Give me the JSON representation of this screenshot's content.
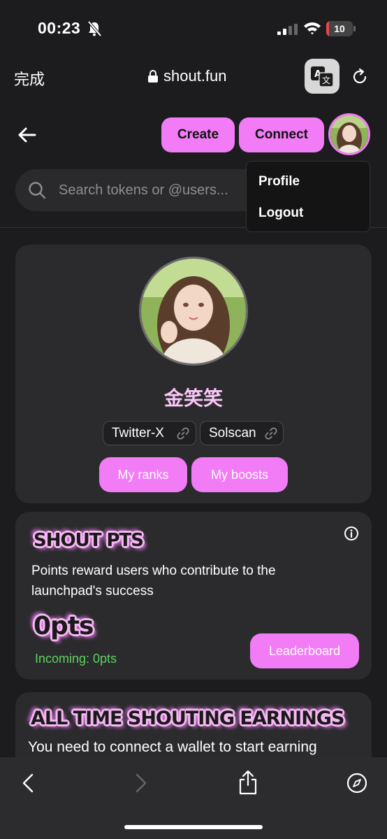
{
  "status_bar": {
    "time": "00:23",
    "battery_level": "10",
    "battery_fraction": 0.1,
    "battery_color": "#e5484d",
    "icons": [
      "bell-slash-icon",
      "signal-icon",
      "wifi-icon",
      "battery-icon"
    ]
  },
  "browser": {
    "done_label": "完成",
    "url": "shout.fun",
    "icons": [
      "lock-icon",
      "translate-icon",
      "reload-icon"
    ]
  },
  "header": {
    "create_label": "Create",
    "connect_label": "Connect",
    "icons": [
      "back-arrow-icon"
    ]
  },
  "search": {
    "placeholder": "Search tokens or @users...",
    "value": ""
  },
  "menu": {
    "items": [
      {
        "label": "Profile"
      },
      {
        "label": "Logout"
      }
    ]
  },
  "profile": {
    "name": "金笑笑",
    "links": [
      {
        "label": "Twitter-X",
        "icon": "link-icon"
      },
      {
        "label": "Solscan",
        "icon": "link-icon"
      }
    ],
    "my_ranks_label": "My ranks",
    "my_boosts_label": "My boosts"
  },
  "shout_pts": {
    "title": "SHOUT PTS",
    "description": "Points reward users who contribute to the launchpad's success",
    "value": "0pts",
    "incoming": "Incoming: 0pts",
    "leaderboard_label": "Leaderboard",
    "icons": [
      "info-icon"
    ]
  },
  "earnings": {
    "title": "ALL TIME SHOUTING EARNINGS",
    "description": "You need to connect a wallet to start earning"
  },
  "toolbar": {
    "icons": [
      "back-icon",
      "forward-icon",
      "share-icon",
      "compass-icon"
    ]
  },
  "colors": {
    "accent": "#f17cf6",
    "background": "#1c1c1e",
    "card": "#2b2b2d",
    "incoming_green": "#5ed15e",
    "name_pink": "#f9c6f6"
  }
}
